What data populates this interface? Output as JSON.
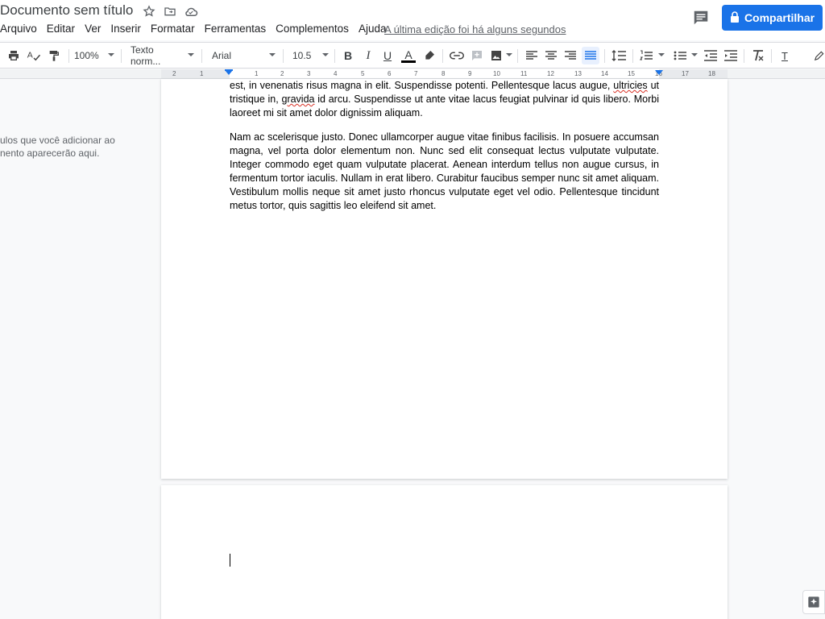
{
  "header": {
    "title": "Documento sem título",
    "menu": [
      "Arquivo",
      "Editar",
      "Ver",
      "Inserir",
      "Formatar",
      "Ferramentas",
      "Complementos",
      "Ajuda"
    ],
    "last_edit": "A última edição foi há alguns segundos",
    "share_label": "Compartilhar"
  },
  "toolbar": {
    "zoom": "100%",
    "style": "Texto norm...",
    "font": "Arial",
    "font_size": "10.5",
    "bold": "B",
    "italic": "I",
    "underline": "U",
    "text_color_letter": "A",
    "clear_format_letter": "T",
    "colors": {
      "text_color_bar": "#000000",
      "active_align_bg": "#e8f0fe",
      "share_bg": "#1a73e8"
    }
  },
  "ruler": {
    "labels": [
      "2",
      "1",
      "1",
      "2",
      "3",
      "4",
      "5",
      "6",
      "7",
      "8",
      "9",
      "10",
      "11",
      "12",
      "13",
      "14",
      "15",
      "16",
      "17",
      "18"
    ]
  },
  "outline": {
    "line1": "ulos que você adicionar ao",
    "line2": "nento aparecerão aqui."
  },
  "document": {
    "p1_a": "est, in venenatis risus magna in elit. Suspendisse potenti. Pellentesque lacus augue, ",
    "p1_spell1": "ultricies",
    "p1_b": " ut tristique in, ",
    "p1_spell2": "gravida",
    "p1_c": " id arcu. Suspendisse ut ante vitae lacus feugiat pulvinar id quis libero. Morbi laoreet mi sit amet dolor dignissim aliquam.",
    "p2": "Nam ac scelerisque justo. Donec ullamcorper augue vitae finibus facilisis. In posuere accumsan magna, vel porta dolor elementum non. Nunc sed elit consequat lectus vulputate vulputate. Integer commodo eget quam vulputate placerat. Aenean interdum tellus non augue cursus, in fermentum tortor iaculis. Nullam in erat libero. Curabitur faucibus semper nunc sit amet aliquam. Vestibulum mollis neque sit amet justo rhoncus vulputate eget vel odio. Pellentesque tincidunt metus tortor, quis sagittis leo eleifend sit amet."
  }
}
